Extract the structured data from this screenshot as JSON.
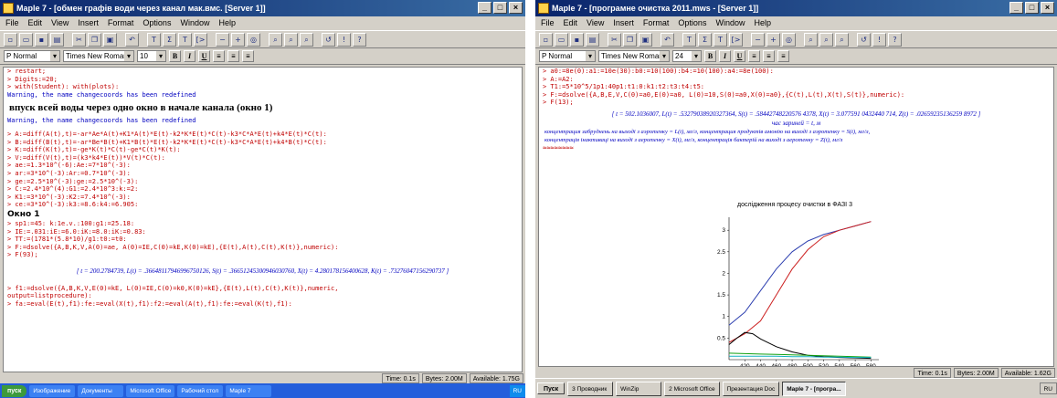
{
  "left": {
    "title": "Maple 7 - [обмен графів води через канал мак.вмс. [Server 1]]",
    "menu": [
      "File",
      "Edit",
      "View",
      "Insert",
      "Format",
      "Options",
      "Window",
      "Help"
    ],
    "style_select": "P Normal",
    "font_select": "Times New Roman",
    "size_select": "10",
    "lines_top": [
      "> restart;",
      "> Digits:=20;",
      "> with(Student): with(plots):",
      "Warning, the name changecoords has been redefined"
    ],
    "heading": "впуск всей воды через одно окно в начале канала (окно 1)",
    "warning2": "Warning, the name changecoords has been redefined",
    "lines_mid": [
      "> A:=diff(A(t),t)=-ar*Ae*A(t)+K1*A(t)*E(t)-k2*K*E(t)*C(t)-k3*C*A*E(t)+k4*E(t)*C(t):",
      "> B:=diff(B(t),t)=-ar*Be*B(t)+K1*B(t)*E(t)-k2*K*E(t)*C(t)-k3*C*A*E(t)+k4*B(t)*C(t):",
      "> K:=diff(K(t),t)=-ge*K(t)*C(t)-ge*C(t)*K(t):",
      "> V:=diff(V(t),t)=(k3*k4*E(t))*V(t)*C(t):",
      "> ae:=1.3*10^(-6):Ae:=7*10^(-3):",
      "> ar:=3*10^(-3):Ar:=0.7*10^(-3):",
      "> ge:=2.5*10^(-3):ge:=2.5*10^(-3):",
      "> C:=2.4*10^(4):G1:=2.4*10^3:k:=2:",
      "> K1:=3*10^(-3):K2:=7.4*10^(-3):",
      "> ce:=3*10^(-3):k3:=8.6:k4:=6.905:"
    ],
    "label_bold": "Окно 1",
    "lines_low": [
      "> sp1:=45: k:1e.v.:100:g1:=25.18:",
      "> IE:=.031:iE:=6.0:iK:=8.0:iK:=0.83:",
      "> TT:=(1781*(5.8*10)/g1:t0:=t0:",
      "> F:=dsolve({A,B,K,V,A(0)=ae, A(0)=IE,C(0)=kE,K(0)=kE),{E(t),A(t),C(t),K(t)},numeric):",
      "> F(93);"
    ],
    "output": "[ t = 200.2784739, L(t) = .36648117946996750126, S(t) = .36651245300946030760, X(t) = 4.280178156400628, K(t) = .73276047156290737 ]",
    "lines_end": [
      "> f1:=dsolve({A,B,K,V,E(0)=kE, L(0)=IE,C(0)=k0,K(0)=kE},{E(t),L(t),C(t),K(t)},numeric,",
      "  output=listprocedure):",
      "> fa:=eval(E(t),f1):fe:=eval(X(t),f1):f2:=eval(A(t),f1):fe:=eval(K(t),f1):"
    ],
    "status": [
      "Time: 0.1s",
      "Bytes: 2.00M",
      "Available: 1.75G"
    ],
    "taskbar_start": "пуск",
    "tasks": [
      "Изображение",
      "Документы",
      "Microsoft Office",
      "Рабочий стол",
      "Maple 7"
    ],
    "tray": "RU"
  },
  "right": {
    "title": "Maple 7 - [програмне очистка 2011.mws - [Server 1]]",
    "menu": [
      "File",
      "Edit",
      "View",
      "Insert",
      "Format",
      "Options",
      "Window",
      "Help"
    ],
    "style_select": "P Normal",
    "font_select": "Times New Roman",
    "size_select": "24",
    "lines": [
      "> a0:=8e(0):a1:=10e(30):b0:=10(100):b4:=10(100):a4:=8e(100):",
      "> A:=A2:",
      "> T1:=5*10^5/1p1:40p1:t1:0:k1:t2:t3:t4:t5:",
      "> F:=dsolve({A,B,E,V,C(0)=a0,E(0)=a0, L(0)=10,S(0)=a0,X(0)=a0},{C(t),L(t),X(t),S(t)},numeric):",
      "> F(13);"
    ],
    "output": "[ t = 502.1036007, L(t) = .53279038920327364, S(t) = .58442748220576 4378, X(t) = 3.077591 0432440 714, Z(t) = .02659235136259 8972 ]",
    "output_label": "час зариней = t, м",
    "caption1": "концентрация забруднень на выході з аэротенку = L(t), мг/л, концентрация продуктів амонію на виході з аэротенку = S(t), мг/л,",
    "caption2": "концентрація інактиваці на виході з аеротенку = X(t), мг/л, концентрація бактерій на виході з аеротенку = Z(t), мг/л",
    "red_mark": "≈≈≈≈≈≈≈≈",
    "status": [
      "Time: 0.1s",
      "Bytes: 2.00M",
      "Available: 1.62G"
    ],
    "taskbar_start": "Пуск",
    "tasks": [
      "3 Проводник",
      "WinZip",
      "2 Microsoft Office",
      "Презентация Doc",
      "Maple 7 - [програ..."
    ],
    "tray": "RU"
  },
  "chart_data": {
    "type": "line",
    "title": "дослідження процесу очистки в ФАЗІ 3",
    "xlabel": "",
    "ylabel": "",
    "xlim": [
      400,
      590
    ],
    "ylim": [
      0,
      3.3
    ],
    "x_ticks": [
      420,
      440,
      460,
      480,
      500,
      520,
      540,
      560,
      580
    ],
    "y_ticks": [
      0.5,
      1,
      1.5,
      2,
      2.5,
      3
    ],
    "y_tick_labels": [
      "0.5",
      "1",
      "1.5",
      "2",
      "2.5",
      "3"
    ],
    "series": [
      {
        "color": "#2d3fb0",
        "x": [
          400,
          420,
          440,
          460,
          480,
          500,
          520,
          540,
          560,
          580
        ],
        "y": [
          0.8,
          1.1,
          1.6,
          2.1,
          2.5,
          2.75,
          2.9,
          3.0,
          3.1,
          3.2
        ]
      },
      {
        "color": "#cc2020",
        "x": [
          400,
          420,
          440,
          460,
          480,
          500,
          520,
          540,
          560,
          580
        ],
        "y": [
          0.4,
          0.6,
          0.9,
          1.5,
          2.1,
          2.55,
          2.85,
          3.0,
          3.1,
          3.2
        ]
      },
      {
        "color": "#000000",
        "x": [
          400,
          410,
          420,
          430,
          440,
          460,
          480,
          500,
          520,
          540,
          560,
          580
        ],
        "y": [
          0.35,
          0.5,
          0.63,
          0.6,
          0.48,
          0.3,
          0.18,
          0.1,
          0.07,
          0.05,
          0.04,
          0.03
        ]
      },
      {
        "color": "#10a010",
        "x": [
          400,
          420,
          440,
          460,
          480,
          500,
          520,
          540,
          560,
          580
        ],
        "y": [
          0.15,
          0.14,
          0.13,
          0.12,
          0.11,
          0.1,
          0.09,
          0.08,
          0.07,
          0.06
        ]
      },
      {
        "color": "#10b0c0",
        "x": [
          400,
          420,
          440,
          460,
          480,
          500,
          520,
          540,
          560,
          580
        ],
        "y": [
          0.08,
          0.08,
          0.08,
          0.08,
          0.07,
          0.07,
          0.06,
          0.06,
          0.05,
          0.05
        ]
      }
    ]
  }
}
